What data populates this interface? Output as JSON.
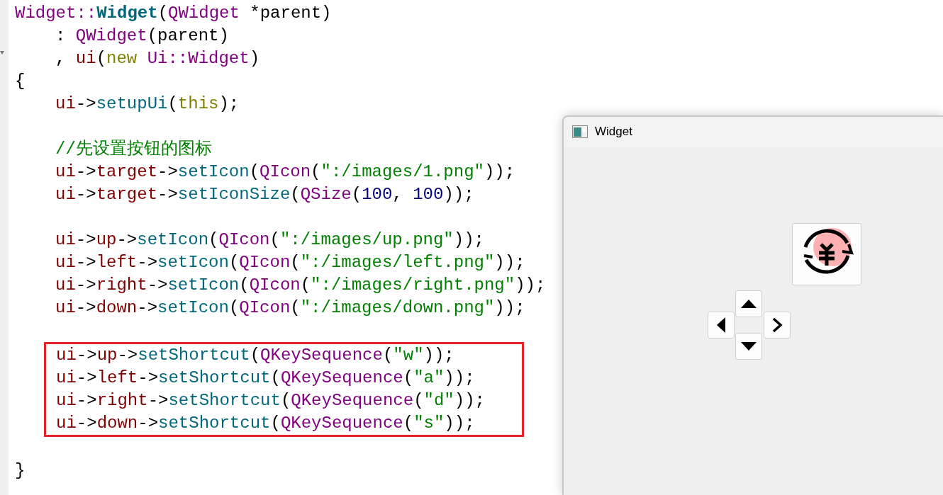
{
  "editor": {
    "blocks": [
      {
        "kind": "plain",
        "lines": [
          {
            "kind": "code",
            "indented": false,
            "tokens": [
              {
                "kind": "type",
                "text": "Widget::"
              },
              {
                "kind": "funcdef",
                "text": "Widget"
              },
              {
                "kind": "plain",
                "text": "("
              },
              {
                "kind": "type",
                "text": "QWidget"
              },
              {
                "kind": "plain",
                "text": " *parent)"
              }
            ]
          },
          {
            "kind": "code",
            "indented": true,
            "tokens": [
              {
                "kind": "plain",
                "text": ": "
              },
              {
                "kind": "type",
                "text": "QWidget"
              },
              {
                "kind": "plain",
                "text": "(parent)"
              }
            ]
          },
          {
            "kind": "code",
            "indented": true,
            "tokens": [
              {
                "kind": "plain",
                "text": ", "
              },
              {
                "kind": "member",
                "text": "ui"
              },
              {
                "kind": "plain",
                "text": "("
              },
              {
                "kind": "keyword",
                "text": "new "
              },
              {
                "kind": "type",
                "text": "Ui::Widget"
              },
              {
                "kind": "plain",
                "text": ")"
              }
            ]
          },
          {
            "kind": "code",
            "indented": false,
            "tokens": [
              {
                "kind": "plain",
                "text": "{"
              }
            ]
          },
          {
            "kind": "code",
            "indented": true,
            "tokens": [
              {
                "kind": "member",
                "text": "ui"
              },
              {
                "kind": "plain",
                "text": "->"
              },
              {
                "kind": "func",
                "text": "setupUi"
              },
              {
                "kind": "plain",
                "text": "("
              },
              {
                "kind": "keyword",
                "text": "this"
              },
              {
                "kind": "plain",
                "text": ");"
              }
            ]
          },
          {
            "kind": "blank"
          },
          {
            "kind": "code",
            "indented": true,
            "tokens": [
              {
                "kind": "comment",
                "text": "//先设置按钮的图标"
              }
            ]
          },
          {
            "kind": "code",
            "indented": true,
            "tokens": [
              {
                "kind": "member",
                "text": "ui"
              },
              {
                "kind": "plain",
                "text": "->"
              },
              {
                "kind": "member",
                "text": "target"
              },
              {
                "kind": "plain",
                "text": "->"
              },
              {
                "kind": "func",
                "text": "setIcon"
              },
              {
                "kind": "plain",
                "text": "("
              },
              {
                "kind": "type",
                "text": "QIcon"
              },
              {
                "kind": "plain",
                "text": "("
              },
              {
                "kind": "string",
                "text": "\":/images/1.png\""
              },
              {
                "kind": "plain",
                "text": "));"
              }
            ]
          },
          {
            "kind": "code",
            "indented": true,
            "tokens": [
              {
                "kind": "member",
                "text": "ui"
              },
              {
                "kind": "plain",
                "text": "->"
              },
              {
                "kind": "member",
                "text": "target"
              },
              {
                "kind": "plain",
                "text": "->"
              },
              {
                "kind": "func",
                "text": "setIconSize"
              },
              {
                "kind": "plain",
                "text": "("
              },
              {
                "kind": "type",
                "text": "QSize"
              },
              {
                "kind": "plain",
                "text": "("
              },
              {
                "kind": "number",
                "text": "100"
              },
              {
                "kind": "plain",
                "text": ", "
              },
              {
                "kind": "number",
                "text": "100"
              },
              {
                "kind": "plain",
                "text": "));"
              }
            ]
          },
          {
            "kind": "blank"
          },
          {
            "kind": "code",
            "indented": true,
            "tokens": [
              {
                "kind": "member",
                "text": "ui"
              },
              {
                "kind": "plain",
                "text": "->"
              },
              {
                "kind": "member",
                "text": "up"
              },
              {
                "kind": "plain",
                "text": "->"
              },
              {
                "kind": "func",
                "text": "setIcon"
              },
              {
                "kind": "plain",
                "text": "("
              },
              {
                "kind": "type",
                "text": "QIcon"
              },
              {
                "kind": "plain",
                "text": "("
              },
              {
                "kind": "string",
                "text": "\":/images/up.png\""
              },
              {
                "kind": "plain",
                "text": "));"
              }
            ]
          },
          {
            "kind": "code",
            "indented": true,
            "tokens": [
              {
                "kind": "member",
                "text": "ui"
              },
              {
                "kind": "plain",
                "text": "->"
              },
              {
                "kind": "member",
                "text": "left"
              },
              {
                "kind": "plain",
                "text": "->"
              },
              {
                "kind": "func",
                "text": "setIcon"
              },
              {
                "kind": "plain",
                "text": "("
              },
              {
                "kind": "type",
                "text": "QIcon"
              },
              {
                "kind": "plain",
                "text": "("
              },
              {
                "kind": "string",
                "text": "\":/images/left.png\""
              },
              {
                "kind": "plain",
                "text": "));"
              }
            ]
          },
          {
            "kind": "code",
            "indented": true,
            "tokens": [
              {
                "kind": "member",
                "text": "ui"
              },
              {
                "kind": "plain",
                "text": "->"
              },
              {
                "kind": "member",
                "text": "right"
              },
              {
                "kind": "plain",
                "text": "->"
              },
              {
                "kind": "func",
                "text": "setIcon"
              },
              {
                "kind": "plain",
                "text": "("
              },
              {
                "kind": "type",
                "text": "QIcon"
              },
              {
                "kind": "plain",
                "text": "("
              },
              {
                "kind": "string",
                "text": "\":/images/right.png\""
              },
              {
                "kind": "plain",
                "text": "));"
              }
            ]
          },
          {
            "kind": "code",
            "indented": true,
            "tokens": [
              {
                "kind": "member",
                "text": "ui"
              },
              {
                "kind": "plain",
                "text": "->"
              },
              {
                "kind": "member",
                "text": "down"
              },
              {
                "kind": "plain",
                "text": "->"
              },
              {
                "kind": "func",
                "text": "setIcon"
              },
              {
                "kind": "plain",
                "text": "("
              },
              {
                "kind": "type",
                "text": "QIcon"
              },
              {
                "kind": "plain",
                "text": "("
              },
              {
                "kind": "string",
                "text": "\":/images/down.png\""
              },
              {
                "kind": "plain",
                "text": "));"
              }
            ]
          },
          {
            "kind": "blank"
          }
        ]
      },
      {
        "kind": "boxed",
        "lines": [
          {
            "kind": "code",
            "indented": true,
            "tokens": [
              {
                "kind": "member",
                "text": "ui"
              },
              {
                "kind": "plain",
                "text": "->"
              },
              {
                "kind": "member",
                "text": "up"
              },
              {
                "kind": "plain",
                "text": "->"
              },
              {
                "kind": "func",
                "text": "setShortcut"
              },
              {
                "kind": "plain",
                "text": "("
              },
              {
                "kind": "type",
                "text": "QKeySequence"
              },
              {
                "kind": "plain",
                "text": "("
              },
              {
                "kind": "string",
                "text": "\"w\""
              },
              {
                "kind": "plain",
                "text": "));"
              }
            ]
          },
          {
            "kind": "code",
            "indented": true,
            "tokens": [
              {
                "kind": "member",
                "text": "ui"
              },
              {
                "kind": "plain",
                "text": "->"
              },
              {
                "kind": "member",
                "text": "left"
              },
              {
                "kind": "plain",
                "text": "->"
              },
              {
                "kind": "func",
                "text": "setShortcut"
              },
              {
                "kind": "plain",
                "text": "("
              },
              {
                "kind": "type",
                "text": "QKeySequence"
              },
              {
                "kind": "plain",
                "text": "("
              },
              {
                "kind": "string",
                "text": "\"a\""
              },
              {
                "kind": "plain",
                "text": "));"
              }
            ]
          },
          {
            "kind": "code",
            "indented": true,
            "tokens": [
              {
                "kind": "member",
                "text": "ui"
              },
              {
                "kind": "plain",
                "text": "->"
              },
              {
                "kind": "member",
                "text": "right"
              },
              {
                "kind": "plain",
                "text": "->"
              },
              {
                "kind": "func",
                "text": "setShortcut"
              },
              {
                "kind": "plain",
                "text": "("
              },
              {
                "kind": "type",
                "text": "QKeySequence"
              },
              {
                "kind": "plain",
                "text": "("
              },
              {
                "kind": "string",
                "text": "\"d\""
              },
              {
                "kind": "plain",
                "text": "));"
              }
            ]
          },
          {
            "kind": "code",
            "indented": true,
            "tokens": [
              {
                "kind": "member",
                "text": "ui"
              },
              {
                "kind": "plain",
                "text": "->"
              },
              {
                "kind": "member",
                "text": "down"
              },
              {
                "kind": "plain",
                "text": "->"
              },
              {
                "kind": "func",
                "text": "setShortcut"
              },
              {
                "kind": "plain",
                "text": "("
              },
              {
                "kind": "type",
                "text": "QKeySequence"
              },
              {
                "kind": "plain",
                "text": "("
              },
              {
                "kind": "string",
                "text": "\"s\""
              },
              {
                "kind": "plain",
                "text": "));"
              }
            ]
          }
        ]
      },
      {
        "kind": "plain",
        "lines": [
          {
            "kind": "blank"
          },
          {
            "kind": "code",
            "indented": false,
            "tokens": [
              {
                "kind": "plain",
                "text": "}"
              }
            ]
          }
        ]
      }
    ]
  },
  "window": {
    "title": "Widget",
    "buttons": [
      {
        "kind": "target"
      },
      {
        "kind": "up"
      },
      {
        "kind": "left"
      },
      {
        "kind": "right"
      },
      {
        "kind": "down"
      }
    ]
  }
}
